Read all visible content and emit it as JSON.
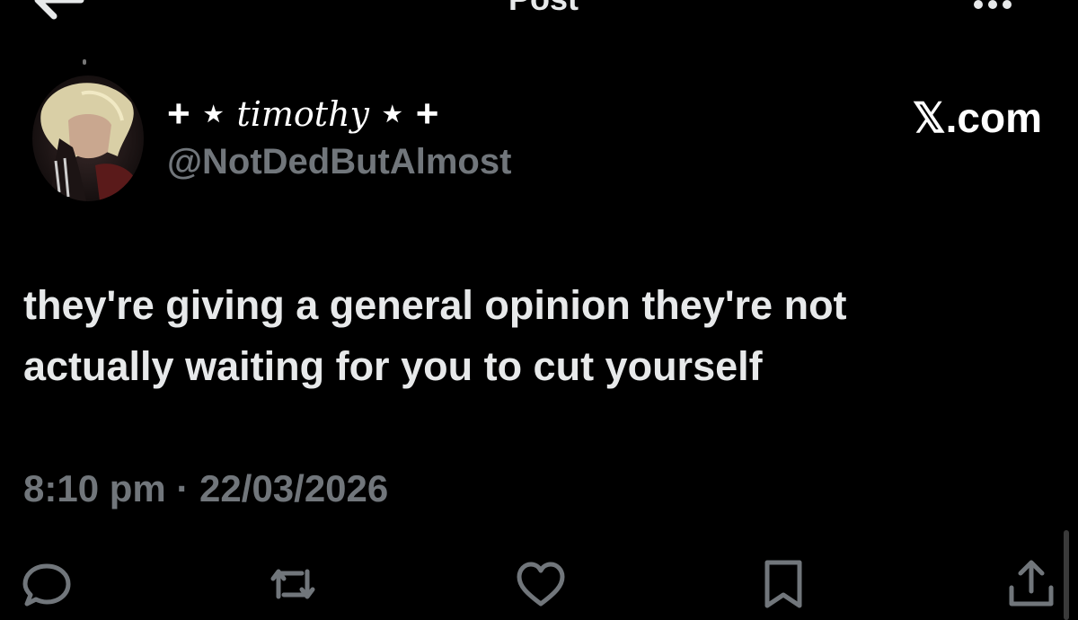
{
  "header": {
    "title": "Post",
    "back_icon": "arrow-left-icon",
    "more_icon": "more-horizontal-icon"
  },
  "author": {
    "name_prefix": "+ ⋆",
    "name": "timothy",
    "name_suffix": "⋆ +",
    "handle": "@NotDedButAlmost",
    "avatar": "avatar-photo"
  },
  "brand": {
    "label": "𝕏.com"
  },
  "post": {
    "lines": [
      "they're giving a general opinion they're not",
      "actually waiting for you to cut yourself"
    ],
    "timestamp": "8:10 pm · 22/03/2026"
  },
  "actions": [
    {
      "icon": "reply-icon"
    },
    {
      "icon": "repost-icon"
    },
    {
      "icon": "like-icon"
    },
    {
      "icon": "bookmark-icon"
    },
    {
      "icon": "share-icon"
    }
  ],
  "colors": {
    "background": "#000000",
    "text": "#e7e9ea",
    "secondary": "#71767b"
  }
}
